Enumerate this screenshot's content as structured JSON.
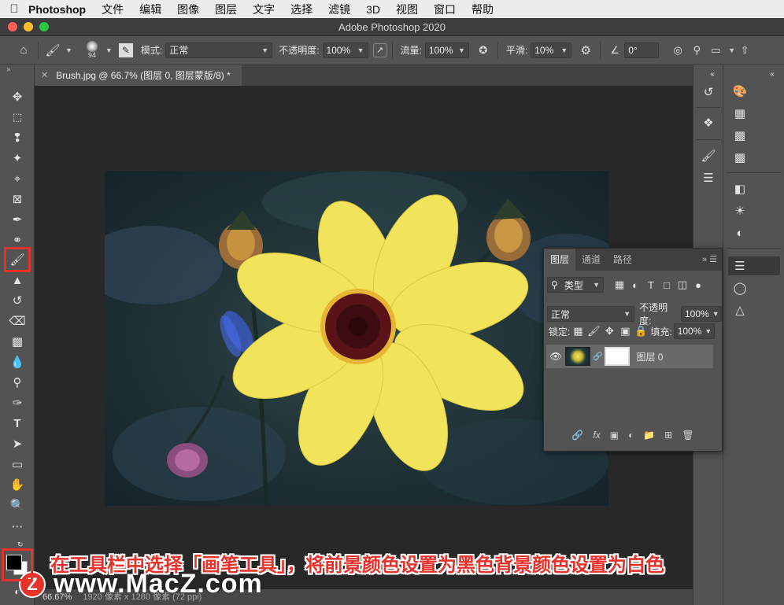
{
  "menubar": {
    "apple_icon": "apple-logo",
    "app_name": "Photoshop",
    "items": [
      "文件",
      "编辑",
      "图像",
      "图层",
      "文字",
      "选择",
      "滤镜",
      "3D",
      "视图",
      "窗口",
      "帮助"
    ]
  },
  "window": {
    "title": "Adobe Photoshop 2020"
  },
  "options_bar": {
    "brush_size": "94",
    "mode_label": "模式:",
    "mode_value": "正常",
    "opacity_label": "不透明度:",
    "opacity_value": "100%",
    "flow_label": "流量:",
    "flow_value": "100%",
    "smoothing_label": "平滑:",
    "smoothing_value": "10%",
    "angle_value": "0°"
  },
  "document_tab": {
    "title": "Brush.jpg @ 66.7% (图层 0, 图层蒙版/8) *"
  },
  "status_bar": {
    "zoom": "66.67%",
    "doc_info": "1920 像素 x 1280 像素 (72 ppi)"
  },
  "layers_panel": {
    "tabs": [
      "图层",
      "通道",
      "路径"
    ],
    "filter_kind": "类型",
    "blend_mode": "正常",
    "opacity_label": "不透明度:",
    "opacity_value": "100%",
    "lock_label": "锁定:",
    "fill_label": "填充:",
    "fill_value": "100%",
    "layer_name": "图层 0"
  },
  "toolbar": {
    "selected_tool": "brush-tool",
    "foreground_color": "#000000",
    "background_color": "#ffffff"
  },
  "caption": "在工具栏中选择「画笔工具」，将前景颜色设置为黑色背景颜色设置为白色",
  "watermark": {
    "logo": "Z",
    "text": "www.MacZ.com"
  },
  "colors": {
    "highlight": "#e5322b",
    "petal": "#f2e45a",
    "center": "#3d0c10"
  }
}
